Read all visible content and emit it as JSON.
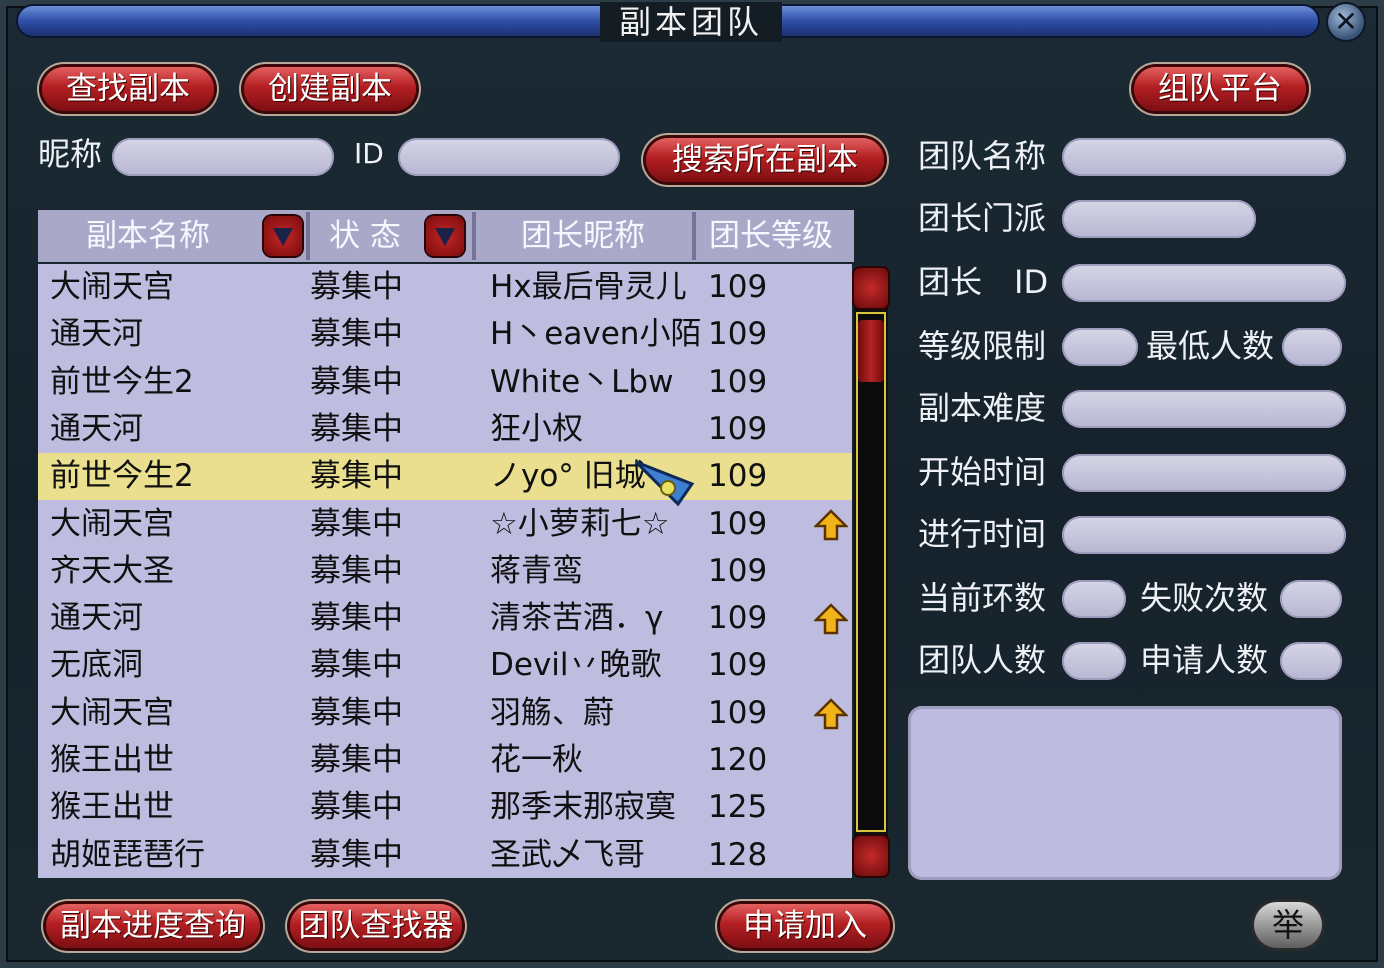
{
  "window": {
    "title": "副本团队",
    "close_icon": "close-icon"
  },
  "top_buttons": {
    "find": "查找副本",
    "create": "创建副本",
    "platform": "组队平台"
  },
  "search": {
    "nickname_label": "昵称",
    "id_label": "ID",
    "nickname_value": "",
    "id_value": "",
    "search_button": "搜索所在副本"
  },
  "table": {
    "headers": [
      "副本名称",
      "状 态",
      "团长昵称",
      "团长等级"
    ],
    "rows": [
      {
        "name": "大闹天宫",
        "status": "募集中",
        "leader": "Hx最后骨灵儿",
        "level": "109",
        "up": false,
        "selected": false
      },
      {
        "name": "通天河",
        "status": "募集中",
        "leader": "H丶eaven小陌",
        "level": "109",
        "up": false,
        "selected": false
      },
      {
        "name": "前世今生2",
        "status": "募集中",
        "leader": "White丶Lbw",
        "level": "109",
        "up": false,
        "selected": false
      },
      {
        "name": "通天河",
        "status": "募集中",
        "leader": "狂小权",
        "level": "109",
        "up": false,
        "selected": false
      },
      {
        "name": "前世今生2",
        "status": "募集中",
        "leader": "ノyo° 旧城",
        "level": "109",
        "up": false,
        "selected": true
      },
      {
        "name": "大闹天宫",
        "status": "募集中",
        "leader": "☆小萝莉七☆",
        "level": "109",
        "up": true,
        "selected": false
      },
      {
        "name": "齐天大圣",
        "status": "募集中",
        "leader": "蒋青鸾",
        "level": "109",
        "up": false,
        "selected": false
      },
      {
        "name": "通天河",
        "status": "募集中",
        "leader": "清茶苦酒．γ",
        "level": "109",
        "up": true,
        "selected": false
      },
      {
        "name": "无底洞",
        "status": "募集中",
        "leader": "Devil丷晚歌",
        "level": "109",
        "up": false,
        "selected": false
      },
      {
        "name": "大闹天宫",
        "status": "募集中",
        "leader": "羽觞、蔚",
        "level": "109",
        "up": true,
        "selected": false
      },
      {
        "name": "猴王出世",
        "status": "募集中",
        "leader": "花一秋",
        "level": "120",
        "up": false,
        "selected": false
      },
      {
        "name": "猴王出世",
        "status": "募集中",
        "leader": "那季末那寂寞",
        "level": "125",
        "up": false,
        "selected": false
      },
      {
        "name": "胡姬琵琶行",
        "status": "募集中",
        "leader": "圣武乄飞哥",
        "level": "128",
        "up": false,
        "selected": false
      }
    ]
  },
  "details": {
    "team_name": "团队名称",
    "leader_school": "团长门派",
    "leader_id": "团长　ID",
    "level_limit": "等级限制",
    "min_members": "最低人数",
    "difficulty": "副本难度",
    "start_time": "开始时间",
    "elapsed_time": "进行时间",
    "current_round": "当前环数",
    "fail_count": "失败次数",
    "team_size": "团队人数",
    "apply_count": "申请人数"
  },
  "bottom_buttons": {
    "progress": "副本进度查询",
    "finder": "团队查找器",
    "apply": "申请加入",
    "report": "举"
  }
}
